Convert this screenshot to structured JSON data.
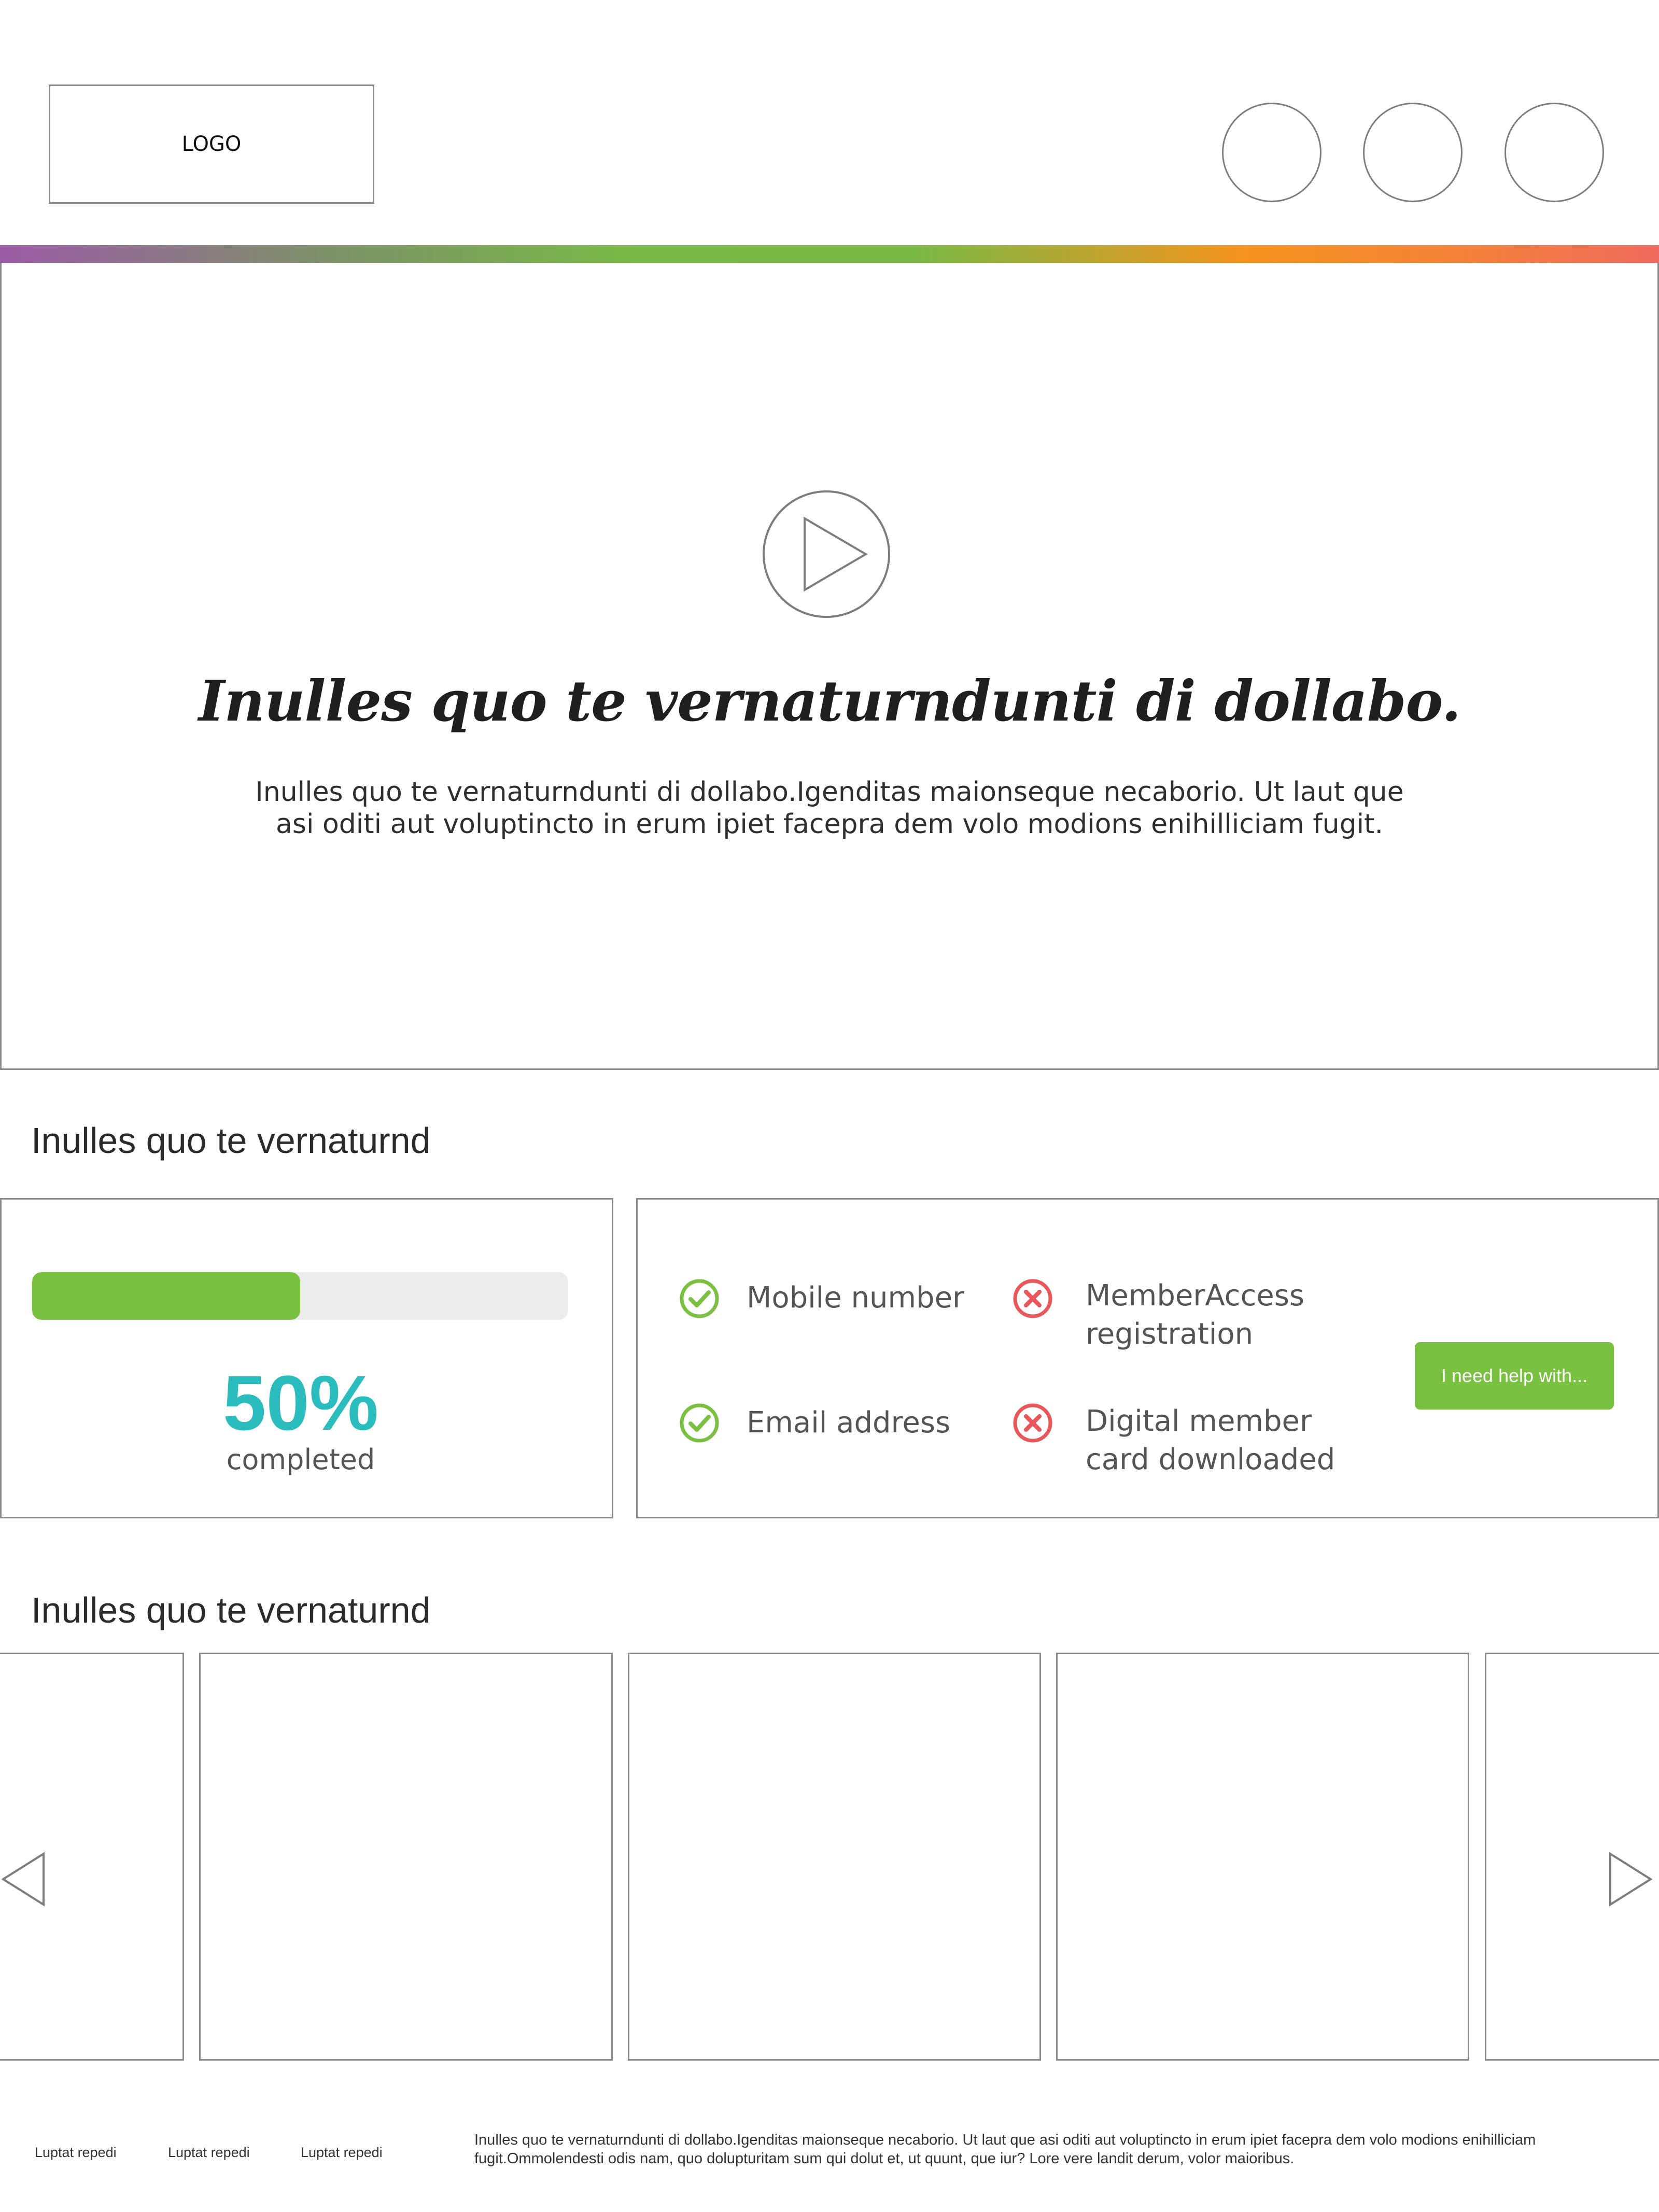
{
  "header": {
    "logo": "LOGO",
    "icons": [
      "circle-icon-1",
      "circle-icon-2",
      "circle-icon-3"
    ]
  },
  "hero": {
    "title": "Inulles quo te vernaturndunti di dollabo.",
    "text": "Inulles quo te vernaturndunti di dollabo.Igenditas maionseque necaborio. Ut laut que asi oditi aut voluptincto in erum ipiet facepra dem volo modions enihilliciam fugit.",
    "play_icon": "play-icon"
  },
  "progress_section": {
    "title": "Inulles quo te vernaturnd",
    "progress_fraction": 0.5,
    "percent": "50%",
    "label": "completed"
  },
  "checklist": {
    "items": [
      {
        "label": "Mobile number",
        "status": "done"
      },
      {
        "label": "Email address",
        "status": "done"
      },
      {
        "label": "MemberAccess registration",
        "status": "missing"
      },
      {
        "label": "Digital member card downloaded",
        "status": "missing"
      }
    ],
    "help_button": "I need help with..."
  },
  "carousel": {
    "title": "Inulles quo te vernaturnd",
    "prev_icon": "chevron-left-icon",
    "next_icon": "chevron-right-icon"
  },
  "footer": {
    "links": [
      "Luptat repedi",
      "Luptat repedi",
      "Luptat repedi"
    ],
    "text": "Inulles quo te vernaturndunti di dollabo.Igenditas maionseque necaborio. Ut laut que asi oditi aut voluptincto in erum ipiet facepra dem volo modions enihilliciam fugit.Ommolendesti odis nam, quo dolupturitam sum qui dolut et, ut quunt, que iur? Lore vere landit derum, volor maioribus."
  },
  "colors": {
    "accent_green": "#7ac142",
    "teal": "#2bbcbd",
    "error_red": "#e8575a"
  }
}
